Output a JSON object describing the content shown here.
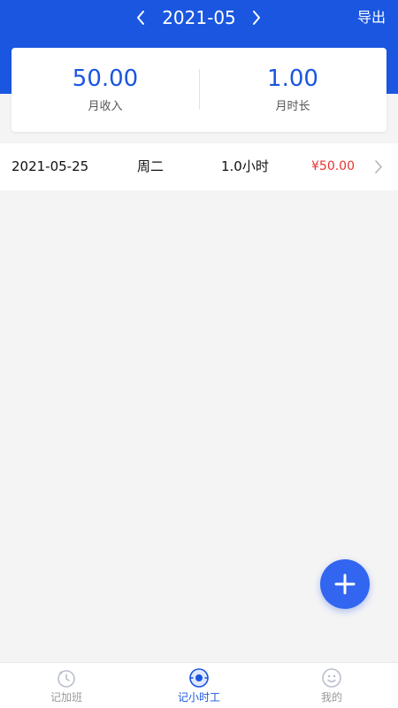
{
  "header": {
    "month": "2021-05",
    "export_label": "导出"
  },
  "summary": {
    "income_value": "50.00",
    "income_label": "月收入",
    "duration_value": "1.00",
    "duration_label": "月时长"
  },
  "records": [
    {
      "date": "2021-05-25",
      "weekday": "周二",
      "hours": "1.0小时",
      "amount": "¥50.00"
    }
  ],
  "tabs": [
    {
      "label": "记加班",
      "icon": "clock-back-icon",
      "active": false
    },
    {
      "label": "记小时工",
      "icon": "timer-icon",
      "active": true
    },
    {
      "label": "我的",
      "icon": "face-icon",
      "active": false
    }
  ],
  "colors": {
    "primary": "#1a56e0",
    "amount": "#e8342f",
    "fab": "#3266f0",
    "background": "#f4f4f5"
  }
}
